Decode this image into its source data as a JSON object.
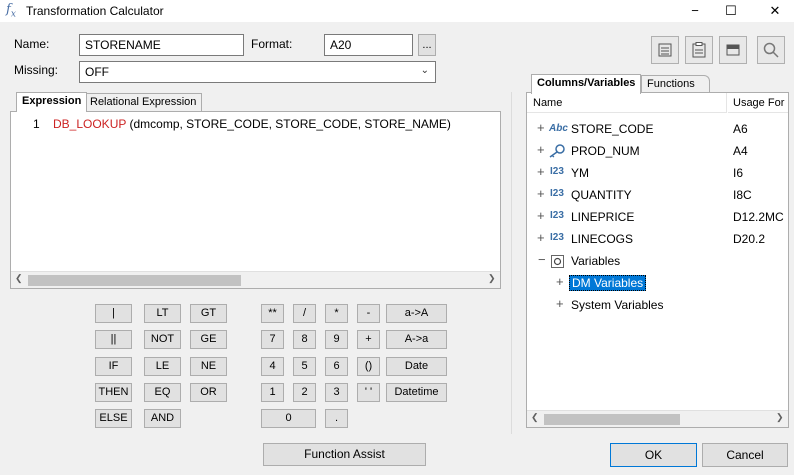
{
  "window": {
    "title": "Transformation Calculator",
    "icon": "fx-icon",
    "controls": [
      "−",
      "☐",
      "✕"
    ]
  },
  "form": {
    "name_label": "Name:",
    "name_value": "STORENAME",
    "format_label": "Format:",
    "format_value": "A20",
    "format_browse": "...",
    "missing_label": "Missing:",
    "missing_value": "OFF"
  },
  "left_tabs": [
    "Expression",
    "Relational Expression"
  ],
  "editor": {
    "line_number": "1",
    "function": "DB_LOOKUP",
    "args": " (dmcomp, STORE_CODE, STORE_CODE, STORE_NAME)"
  },
  "keypad": {
    "ops": [
      "|",
      "LT",
      "GT",
      "||",
      "NOT",
      "GE",
      "IF",
      "LE",
      "NE",
      "THEN",
      "EQ",
      "OR",
      "ELSE",
      "AND"
    ],
    "nums": [
      "**",
      "/",
      "*",
      "-",
      "7",
      "8",
      "9",
      "+",
      "4",
      "5",
      "6",
      "()",
      "1",
      "2",
      "3",
      "' '",
      "0",
      "."
    ],
    "special": [
      "a->A",
      "A->a",
      "Date",
      "Datetime"
    ]
  },
  "right_tabs": [
    "Columns/Variables",
    "Functions"
  ],
  "tree": {
    "col_name": "Name",
    "col_usage": "Usage For",
    "rows": [
      {
        "name": "STORE_CODE",
        "icon": "Abc",
        "usage": "A6"
      },
      {
        "name": "PROD_NUM",
        "icon": "key",
        "usage": "A4"
      },
      {
        "name": "YM",
        "icon": "I23",
        "usage": "I6"
      },
      {
        "name": "QUANTITY",
        "icon": "I23",
        "usage": "I8C"
      },
      {
        "name": "LINEPRICE",
        "icon": "I23",
        "usage": "D12.2MC"
      },
      {
        "name": "LINECOGS",
        "icon": "I23",
        "usage": "D20.2"
      }
    ],
    "variables": "Variables",
    "dm_variables": "DM Variables",
    "system_variables": "System Variables"
  },
  "buttons": {
    "function_assist": "Function Assist",
    "ok": "OK",
    "cancel": "Cancel"
  },
  "colors": {
    "keyword": "#cc2222",
    "selection": "#0078d7",
    "icon_blue": "#3a6ea5"
  }
}
